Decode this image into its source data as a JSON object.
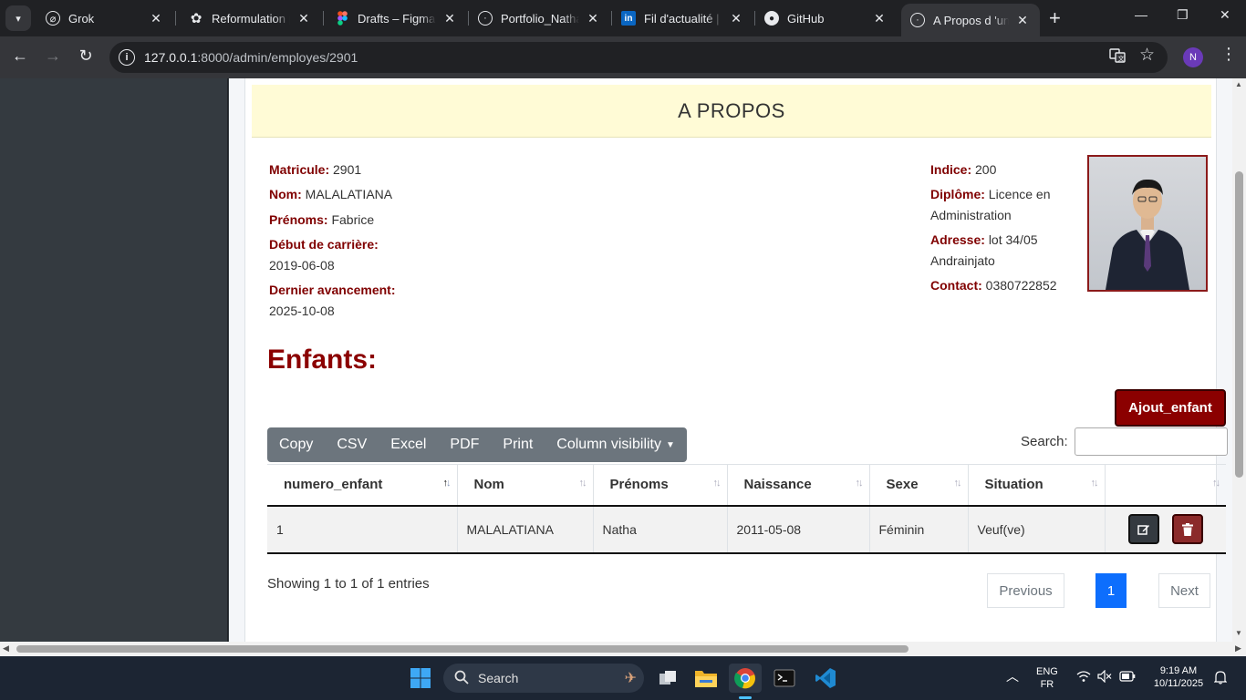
{
  "browser": {
    "tabs": [
      {
        "title": "Grok",
        "icon": "grok-icon"
      },
      {
        "title": "Reformulation p",
        "icon": "openai-icon"
      },
      {
        "title": "Drafts – Figma",
        "icon": "figma-icon"
      },
      {
        "title": "Portfolio_Nathal",
        "icon": "globe-icon"
      },
      {
        "title": "Fil d'actualité | L",
        "icon": "linkedin-icon"
      },
      {
        "title": "GitHub",
        "icon": "github-icon"
      },
      {
        "title": "A Propos d 'un e",
        "icon": "globe-icon"
      }
    ],
    "url_host": "127.0.0.1",
    "url_rest": ":8000/admin/employes/2901",
    "profile_initial": "N"
  },
  "page": {
    "header": "A PROPOS",
    "fields_left": [
      {
        "label": "Matricule:",
        "value": "2901"
      },
      {
        "label": "Nom:",
        "value": "MALALATIANA"
      },
      {
        "label": "Prénoms:",
        "value": "Fabrice"
      },
      {
        "label": "Début de carrière:",
        "value": "2019-06-08"
      },
      {
        "label": "Dernier avancement:",
        "value": "2025-10-08"
      }
    ],
    "fields_right": [
      {
        "label": "Indice:",
        "value": "200"
      },
      {
        "label": "Diplôme:",
        "value": "Licence en Administration"
      },
      {
        "label": "Adresse:",
        "value": "lot 34/05 Andrainjato"
      },
      {
        "label": "Contact:",
        "value": "0380722852"
      }
    ],
    "enfants_title": "Enfants:",
    "add_button": "Ajout_enfant",
    "export_buttons": [
      "Copy",
      "CSV",
      "Excel",
      "PDF",
      "Print",
      "Column visibility"
    ],
    "search_label": "Search:",
    "search_value": "",
    "table": {
      "columns": [
        "numero_enfant",
        "Nom",
        "Prénoms",
        "Naissance",
        "Sexe",
        "Situation",
        ""
      ],
      "rows": [
        [
          "1",
          "MALALATIANA",
          "Natha",
          "2011-05-08",
          "Féminin",
          "Veuf(ve)"
        ]
      ]
    },
    "info": "Showing 1 to 1 of 1 entries",
    "pagination": {
      "previous": "Previous",
      "current": "1",
      "next": "Next"
    }
  },
  "taskbar": {
    "search_placeholder": "Search",
    "lang_top": "ENG",
    "lang_bottom": "FR",
    "time": "9:19 AM",
    "date": "10/11/2025"
  }
}
